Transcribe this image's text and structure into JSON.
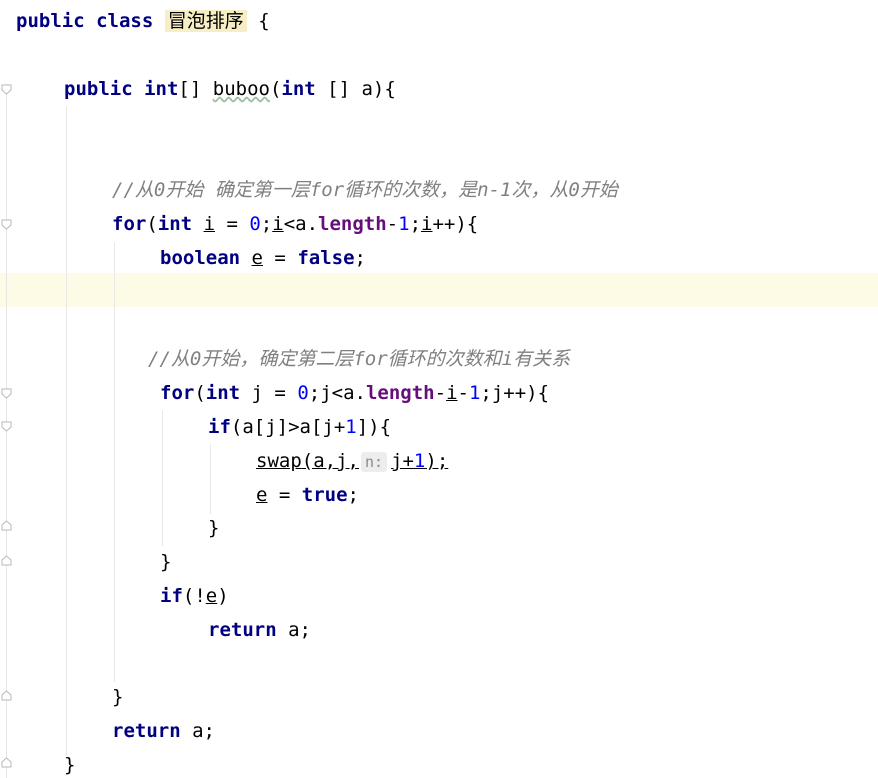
{
  "editor": {
    "class_decl": {
      "kw": "public class",
      "name": "冒泡排序",
      "brace": "{"
    },
    "method_decl": {
      "kw1": "public",
      "kw2": "int",
      "rest1": "[] ",
      "name": "buboo",
      "paren": "(",
      "kw3": "int",
      "rest2": " [] a){"
    },
    "comment1": "//从0开始 确定第一层for循环的次数，是n-1次，从0开始",
    "for1": {
      "kw_for": "for",
      "p1": "(",
      "kw_int": "int",
      "sp": " ",
      "var_i": "i",
      "eq": " = ",
      "zero": "0",
      "semi": ";",
      "var_i2": "i",
      "lt": "<a.",
      "length": "length",
      "minus": "-",
      "one": "1",
      "semi2": ";",
      "var_i3": "i",
      "inc": "++){"
    },
    "bool_line": {
      "kw": "boolean",
      "sp": " ",
      "var": "e",
      "eq": " = ",
      "val": "false",
      "semi": ";"
    },
    "comment2": "//从0开始，确定第二层for循环的次数和i有关系",
    "for2": {
      "kw_for": "for",
      "p1": "(",
      "kw_int": "int",
      "rest": " j = ",
      "zero": "0",
      "mid": ";j<a.",
      "length": "length",
      "minus": "-",
      "var_i": "i",
      "minus2": "-",
      "one": "1",
      "end": ";j++){"
    },
    "if1": {
      "kw": "if",
      "a": "(a[j]>a[j+",
      "one": "1",
      "b": "]){"
    },
    "swap": {
      "name": "swap",
      "args": "(a,j,",
      "hint": "n:",
      "arg3": "j+",
      "one": "1",
      "end": ");"
    },
    "assign": {
      "var": "e",
      "eq": " = ",
      "val": "true",
      "semi": ";"
    },
    "close_brace": "}",
    "if2": {
      "kw": "if",
      "a": "(!",
      "var": "e",
      "b": ")"
    },
    "ret1": {
      "kw": "return",
      "rest": " a;"
    },
    "ret2": {
      "kw": "return",
      "rest": " a;"
    }
  }
}
